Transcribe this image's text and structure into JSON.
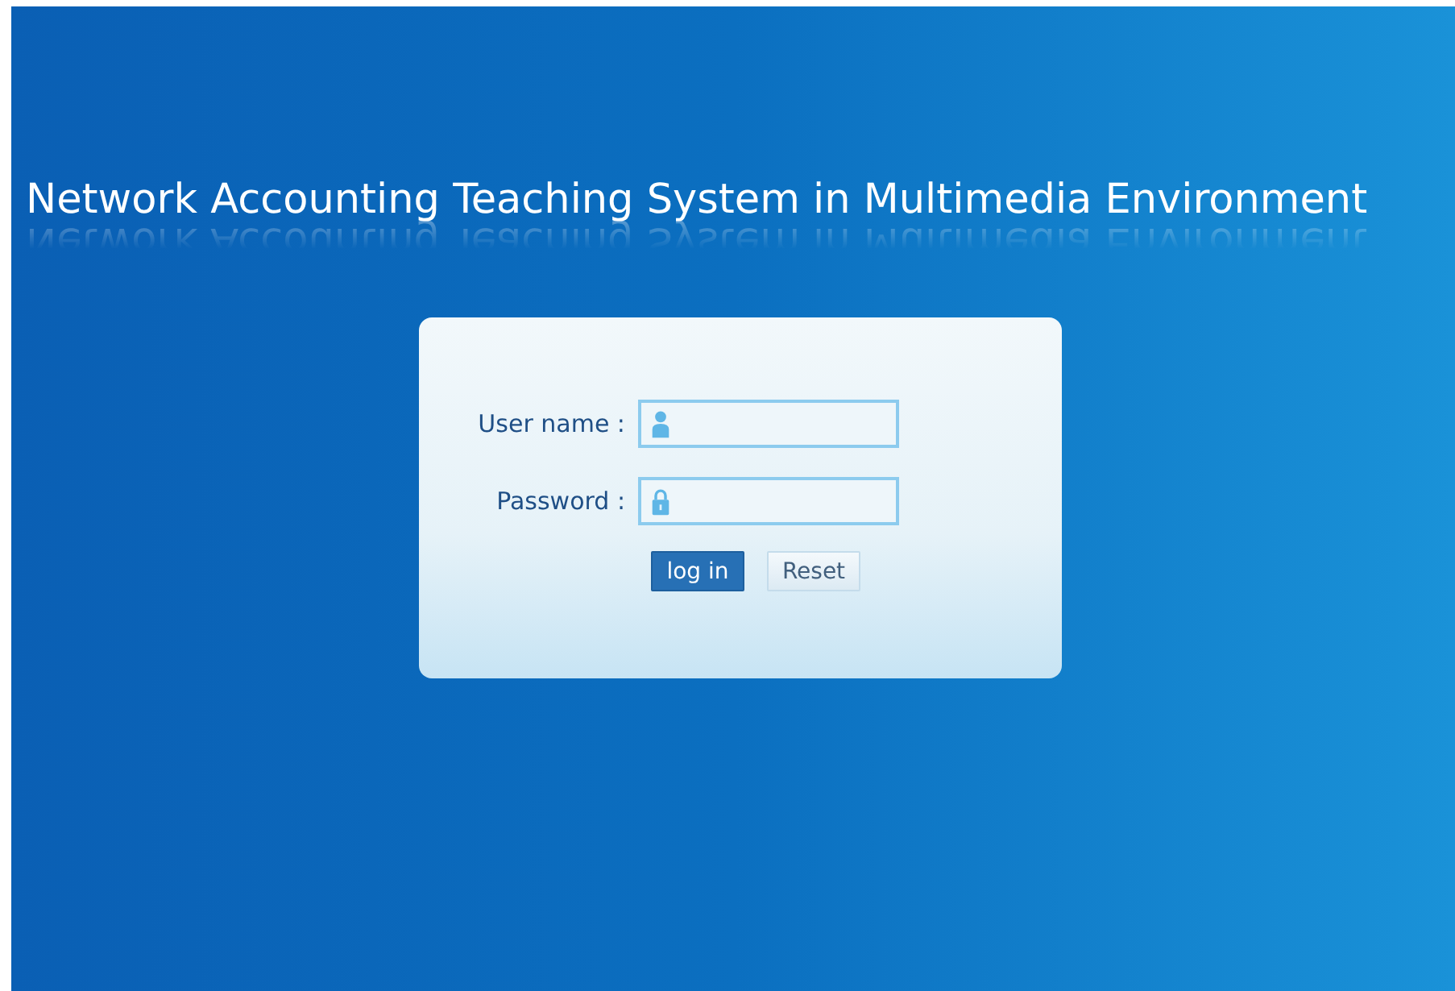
{
  "title": "Network Accounting Teaching System in Multimedia Environment",
  "fields": [
    {
      "label": "User name :",
      "kind": "user"
    },
    {
      "label": "Password :",
      "kind": "password"
    }
  ],
  "buttons": [
    {
      "label": "log in",
      "kind": "primary"
    },
    {
      "label": "Reset",
      "kind": "secondary"
    }
  ]
}
